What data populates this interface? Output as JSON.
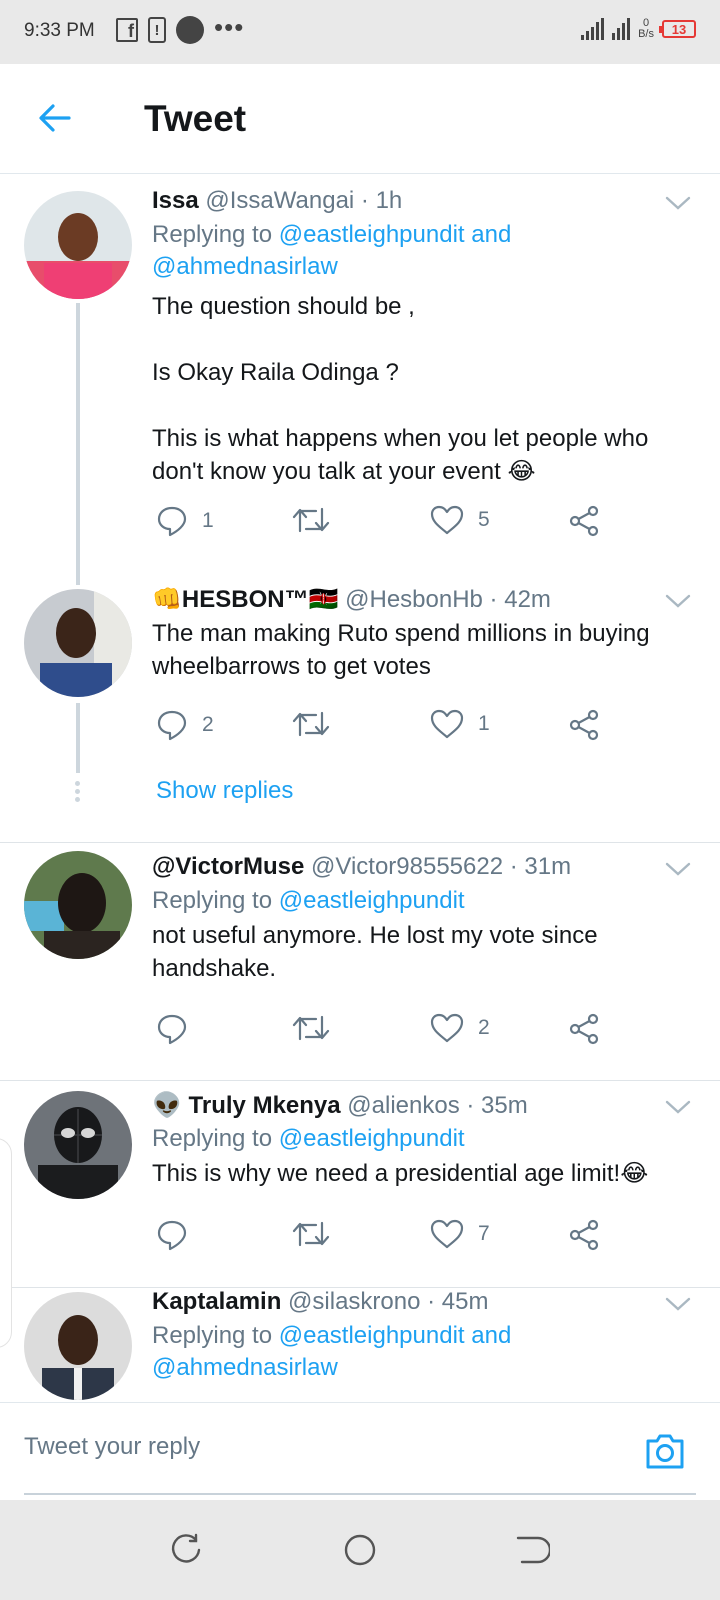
{
  "status": {
    "time": "9:33 PM",
    "net_top": "0",
    "net_unit": "B/s",
    "battery": "13"
  },
  "header": {
    "title": "Tweet"
  },
  "tweets": [
    {
      "name": "Issa",
      "handle": "@IssaWangai · 1h",
      "replying_label": "Replying to",
      "mention1": "@eastleighpundit",
      "and": "and",
      "mention2": "@ahmednasirlaw",
      "text_lines": [
        "The question should be ,",
        "",
        "Is Okay Raila Odinga ?",
        "",
        "This is what happens when you let people who",
        "don't know you talk at your event 😂"
      ],
      "replies": "1",
      "retweets": "",
      "likes": "5"
    },
    {
      "name": "👊HESBON™🇰🇪",
      "handle": "@HesbonHb · 42m",
      "text_lines": [
        "The man making Ruto spend millions in buying",
        "wheelbarrows to get votes"
      ],
      "replies": "2",
      "retweets": "",
      "likes": "1",
      "show_replies": "Show replies"
    },
    {
      "name": "@VictorMuse",
      "handle": "@Victor98555622 · 31m",
      "replying_label": "Replying to",
      "mention1": "@eastleighpundit",
      "text_lines": [
        "not useful anymore. He lost my vote since",
        "handshake."
      ],
      "replies": "",
      "retweets": "",
      "likes": "2"
    },
    {
      "name": "👽 Truly Mkenya",
      "handle": "@alienkos · 35m",
      "replying_label": "Replying to",
      "mention1": "@eastleighpundit",
      "text_lines": [
        "This is why we need a presidential age limit!😂"
      ],
      "replies": "",
      "retweets": "",
      "likes": "7"
    },
    {
      "name": "Kaptalamin",
      "handle": "@silaskrono · 45m",
      "replying_label": "Replying to",
      "mention1": "@eastleighpundit",
      "and": "and",
      "mention2": "@ahmednasirlaw"
    }
  ],
  "reply_bar": {
    "placeholder": "Tweet your reply"
  },
  "colors": {
    "accent": "#1da1f2",
    "muted": "#657786",
    "text": "#14171a"
  }
}
